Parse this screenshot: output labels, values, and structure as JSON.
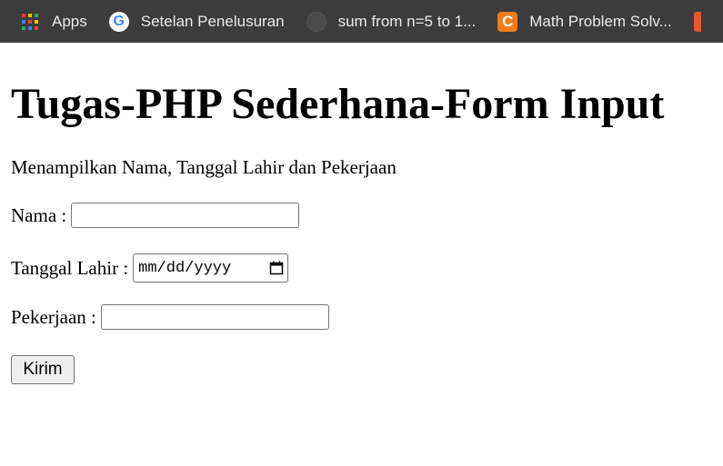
{
  "bookmarks": [
    {
      "label": "Apps",
      "icon": "apps-grid-icon"
    },
    {
      "label": "Setelan Penelusuran",
      "icon": "google-icon"
    },
    {
      "label": "sum from n=5 to 1...",
      "icon": "globe-icon"
    },
    {
      "label": "Math Problem Solv...",
      "icon": "c-logo-icon"
    }
  ],
  "page": {
    "title": "Tugas-PHP Sederhana-Form Input",
    "subtitle": "Menampilkan Nama, Tanggal Lahir dan Pekerjaan"
  },
  "form": {
    "nama_label": "Nama :",
    "nama_value": "",
    "tanggal_label": "Tanggal Lahir :",
    "tanggal_placeholder": "mm/dd/yyyy",
    "pekerjaan_label": "Pekerjaan :",
    "pekerjaan_value": "",
    "submit_label": "Kirim"
  },
  "colors": {
    "bookmarks_bar_bg": "#3c3c3c",
    "bookmark_text": "#e8eaed",
    "c_logo": "#ef7d1a"
  }
}
